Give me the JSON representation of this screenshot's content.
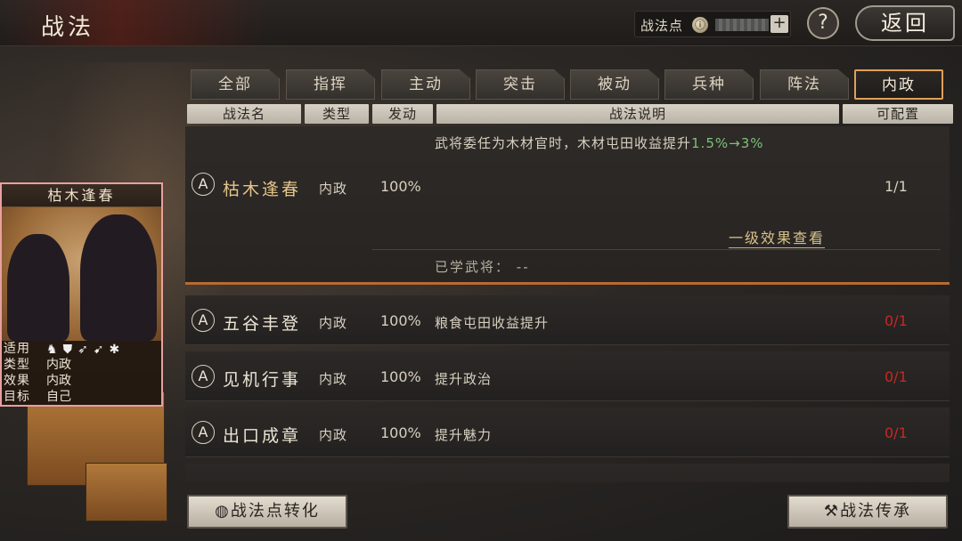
{
  "header": {
    "title": "战法",
    "points_label": "战法点",
    "points_icon": "tactic-point-icon",
    "points_value": "",
    "add_label": "+",
    "help_label": "?",
    "back_label": "返回"
  },
  "tabs": [
    {
      "label": "全部",
      "active": false
    },
    {
      "label": "指挥",
      "active": false
    },
    {
      "label": "主动",
      "active": false
    },
    {
      "label": "突击",
      "active": false
    },
    {
      "label": "被动",
      "active": false
    },
    {
      "label": "兵种",
      "active": false
    },
    {
      "label": "阵法",
      "active": false
    },
    {
      "label": "内政",
      "active": true
    }
  ],
  "columns": [
    "战法名",
    "类型",
    "发动",
    "战法说明",
    "可配置"
  ],
  "expanded": {
    "grade": "A",
    "name": "枯木逢春",
    "type": "内政",
    "rate": "100%",
    "desc_prefix": "武将委任为木材官时，木材屯田收益提升",
    "desc_highlight": "1.5%→3%",
    "count": "1/1",
    "effect_link": "一级效果查看",
    "learned_label": "已学武将：",
    "learned_value": "--"
  },
  "rows": [
    {
      "grade": "A",
      "name": "五谷丰登",
      "type": "内政",
      "rate": "100%",
      "desc": "粮食屯田收益提升",
      "count": "0/1"
    },
    {
      "grade": "A",
      "name": "见机行事",
      "type": "内政",
      "rate": "100%",
      "desc": "提升政治",
      "count": "0/1"
    },
    {
      "grade": "A",
      "name": "出口成章",
      "type": "内政",
      "rate": "100%",
      "desc": "提升魅力",
      "count": "0/1"
    }
  ],
  "card": {
    "title": "枯木逢春",
    "applies_label": "适用",
    "applies_icons": [
      "cavalry-icon",
      "shield-icon",
      "bow-icon",
      "spear-icon",
      "wheel-icon"
    ],
    "type_label": "类型",
    "type_value": "内政",
    "effect_label": "效果",
    "effect_value": "内政",
    "target_label": "目标",
    "target_value": "自己"
  },
  "buttons": {
    "convert_label": "战法点转化",
    "inherit_label": "战法传承"
  },
  "colors": {
    "accent_orange": "#e0a05a",
    "highlight_green": "#7cc27a",
    "count_red": "#c42a22",
    "gold_name": "#e4c48a"
  }
}
